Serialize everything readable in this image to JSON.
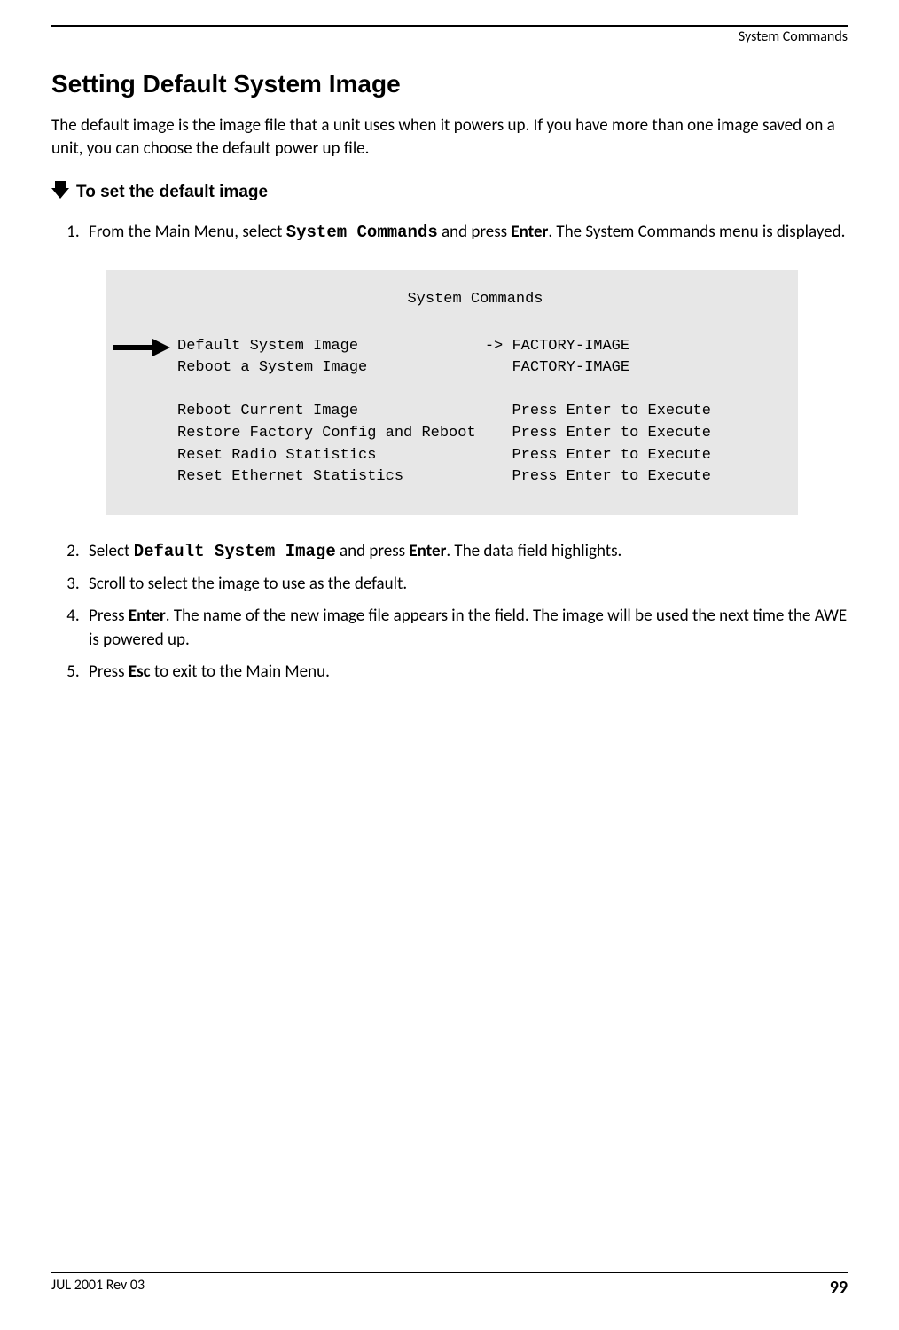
{
  "header": {
    "right_label": "System Commands"
  },
  "title": "Setting Default System Image",
  "intro": "The default image is the image file that a unit uses when it powers up. If you have more than one image saved on a unit, you can choose the default power up file.",
  "subhead": "To set the default image",
  "steps": {
    "s1a": "From the Main Menu, select ",
    "s1_cmd": "System Commands",
    "s1b": " and press ",
    "s1_key": "Enter",
    "s1c": ". The System Commands menu is displayed.",
    "s2a": "Select ",
    "s2_cmd": "Default System Image",
    "s2b": " and press ",
    "s2_key": "Enter",
    "s2c": ". The data field highlights.",
    "s3": "Scroll to select the image to use as the default.",
    "s4a": "Press ",
    "s4_key": "Enter",
    "s4b": ". The name of the new image file appears in the field. The image will be used the next time the AWE is powered up.",
    "s5a": "Press ",
    "s5_key": "Esc",
    "s5b": " to exit to the Main Menu."
  },
  "terminal": {
    "title": "System Commands",
    "rows": [
      {
        "left": "Default System Image",
        "right": "-> FACTORY-IMAGE"
      },
      {
        "left": "Reboot a System Image",
        "right": "   FACTORY-IMAGE"
      },
      {
        "left": "",
        "right": ""
      },
      {
        "left": "Reboot Current Image",
        "right": "   Press Enter to Execute"
      },
      {
        "left": "Restore Factory Config and Reboot",
        "right": "   Press Enter to Execute"
      },
      {
        "left": "Reset Radio Statistics",
        "right": "   Press Enter to Execute"
      },
      {
        "left": "Reset Ethernet Statistics",
        "right": "   Press Enter to Execute"
      }
    ]
  },
  "footer": {
    "left": "JUL 2001 Rev 03",
    "page": "99"
  }
}
